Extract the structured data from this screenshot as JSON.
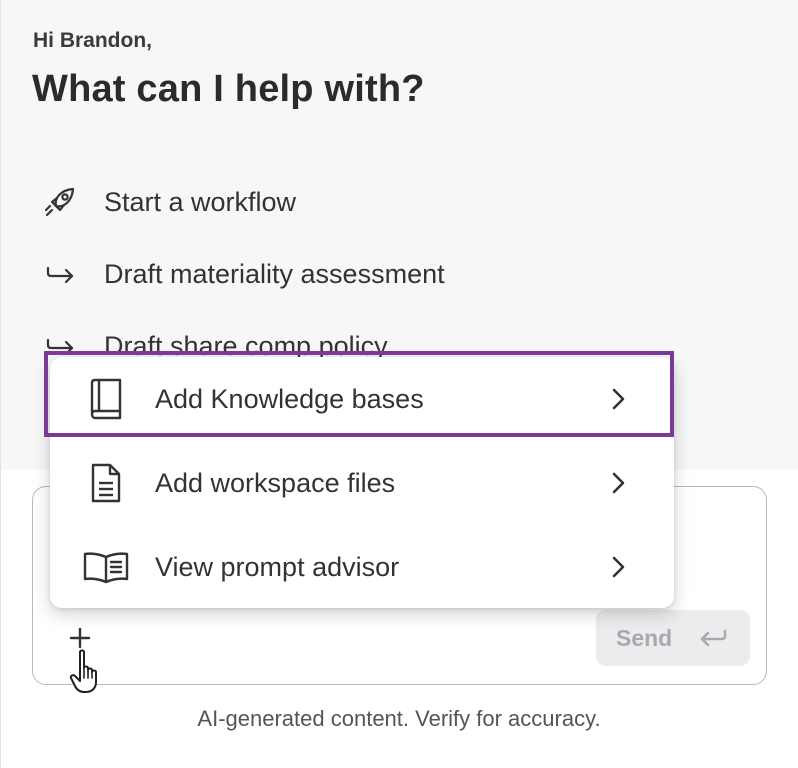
{
  "header": {
    "greeting": "Hi Brandon,",
    "title": "What can I help with?"
  },
  "suggestions": [
    {
      "label": "Start a workflow",
      "icon": "rocket-icon"
    },
    {
      "label": "Draft materiality assessment",
      "icon": "arrow-right-icon"
    },
    {
      "label": "Draft share comp policy",
      "icon": "arrow-right-icon"
    }
  ],
  "menu": {
    "items": [
      {
        "label": "Add Knowledge bases",
        "icon": "book-icon",
        "highlighted": true
      },
      {
        "label": "Add workspace files",
        "icon": "file-icon"
      },
      {
        "label": "View prompt advisor",
        "icon": "open-book-icon"
      }
    ]
  },
  "composer": {
    "send_label": "Send",
    "plus_icon": "plus-icon",
    "enter_icon": "enter-icon"
  },
  "footer": {
    "note": "AI-generated content. Verify for accuracy."
  },
  "colors": {
    "highlight": "#7a3a96",
    "background_top": "#f7f7f8",
    "send_bg": "#ececee",
    "send_text": "#a9a9ad"
  }
}
